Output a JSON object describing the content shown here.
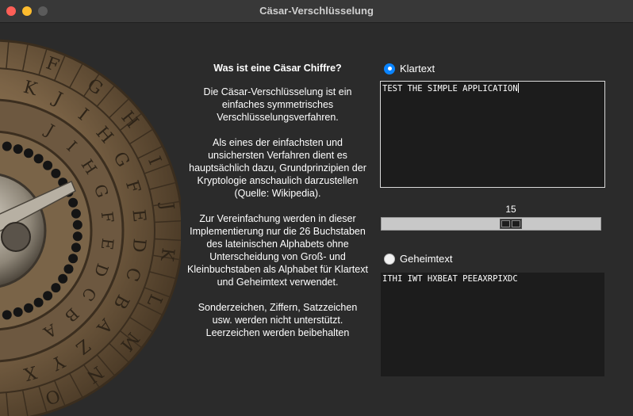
{
  "window": {
    "title": "Cäsar-Verschlüsselung"
  },
  "info": {
    "heading": "Was ist eine Cäsar Chiffre?",
    "paragraphs": [
      "Die Cäsar-Verschlüsselung ist ein einfaches symmetrisches Verschlüsselungsverfahren.",
      "Als eines der einfachsten und unsichersten Verfahren dient es hauptsächlich dazu, Grundprinzipien der Kryptologie anschaulich darzustellen (Quelle: Wikipedia).",
      "Zur Vereinfachung werden in dieser Implementierung nur die 26 Buchstaben des lateinischen Alphabets ohne Unterscheidung von Groß- und Kleinbuchstaben als Alphabet für Klartext und Geheimtext verwendet.",
      "Sonderzeichen, Ziffern, Satzzeichen usw. werden nicht unterstützt. Leerzeichen werden beibehalten"
    ]
  },
  "plaintext": {
    "label": "Klartext",
    "selected": true,
    "value": "TEST THE SIMPLE APPLICATION"
  },
  "shift": {
    "value": "15",
    "min": 0,
    "max": 25
  },
  "ciphertext": {
    "label": "Geheimtext",
    "selected": false,
    "value": "ITHI IWT HXBEAT PEEAXRPIXDC"
  },
  "wheel": {
    "outer_letters": [
      "K",
      "J",
      "I",
      "H",
      "G",
      "F",
      "E",
      "D",
      "C",
      "B",
      "A",
      "Z",
      "Y",
      "X"
    ],
    "inner_letters": [
      "J",
      "I",
      "H",
      "G",
      "F",
      "E",
      "D",
      "C",
      "B",
      "A"
    ],
    "rim_letters": [
      "F",
      "G",
      "H",
      "I",
      "J",
      "K",
      "L",
      "M",
      "N",
      "O"
    ]
  },
  "colors": {
    "accent": "#0a84ff",
    "background": "#2b2b2b",
    "bronze": "#8a7253"
  }
}
